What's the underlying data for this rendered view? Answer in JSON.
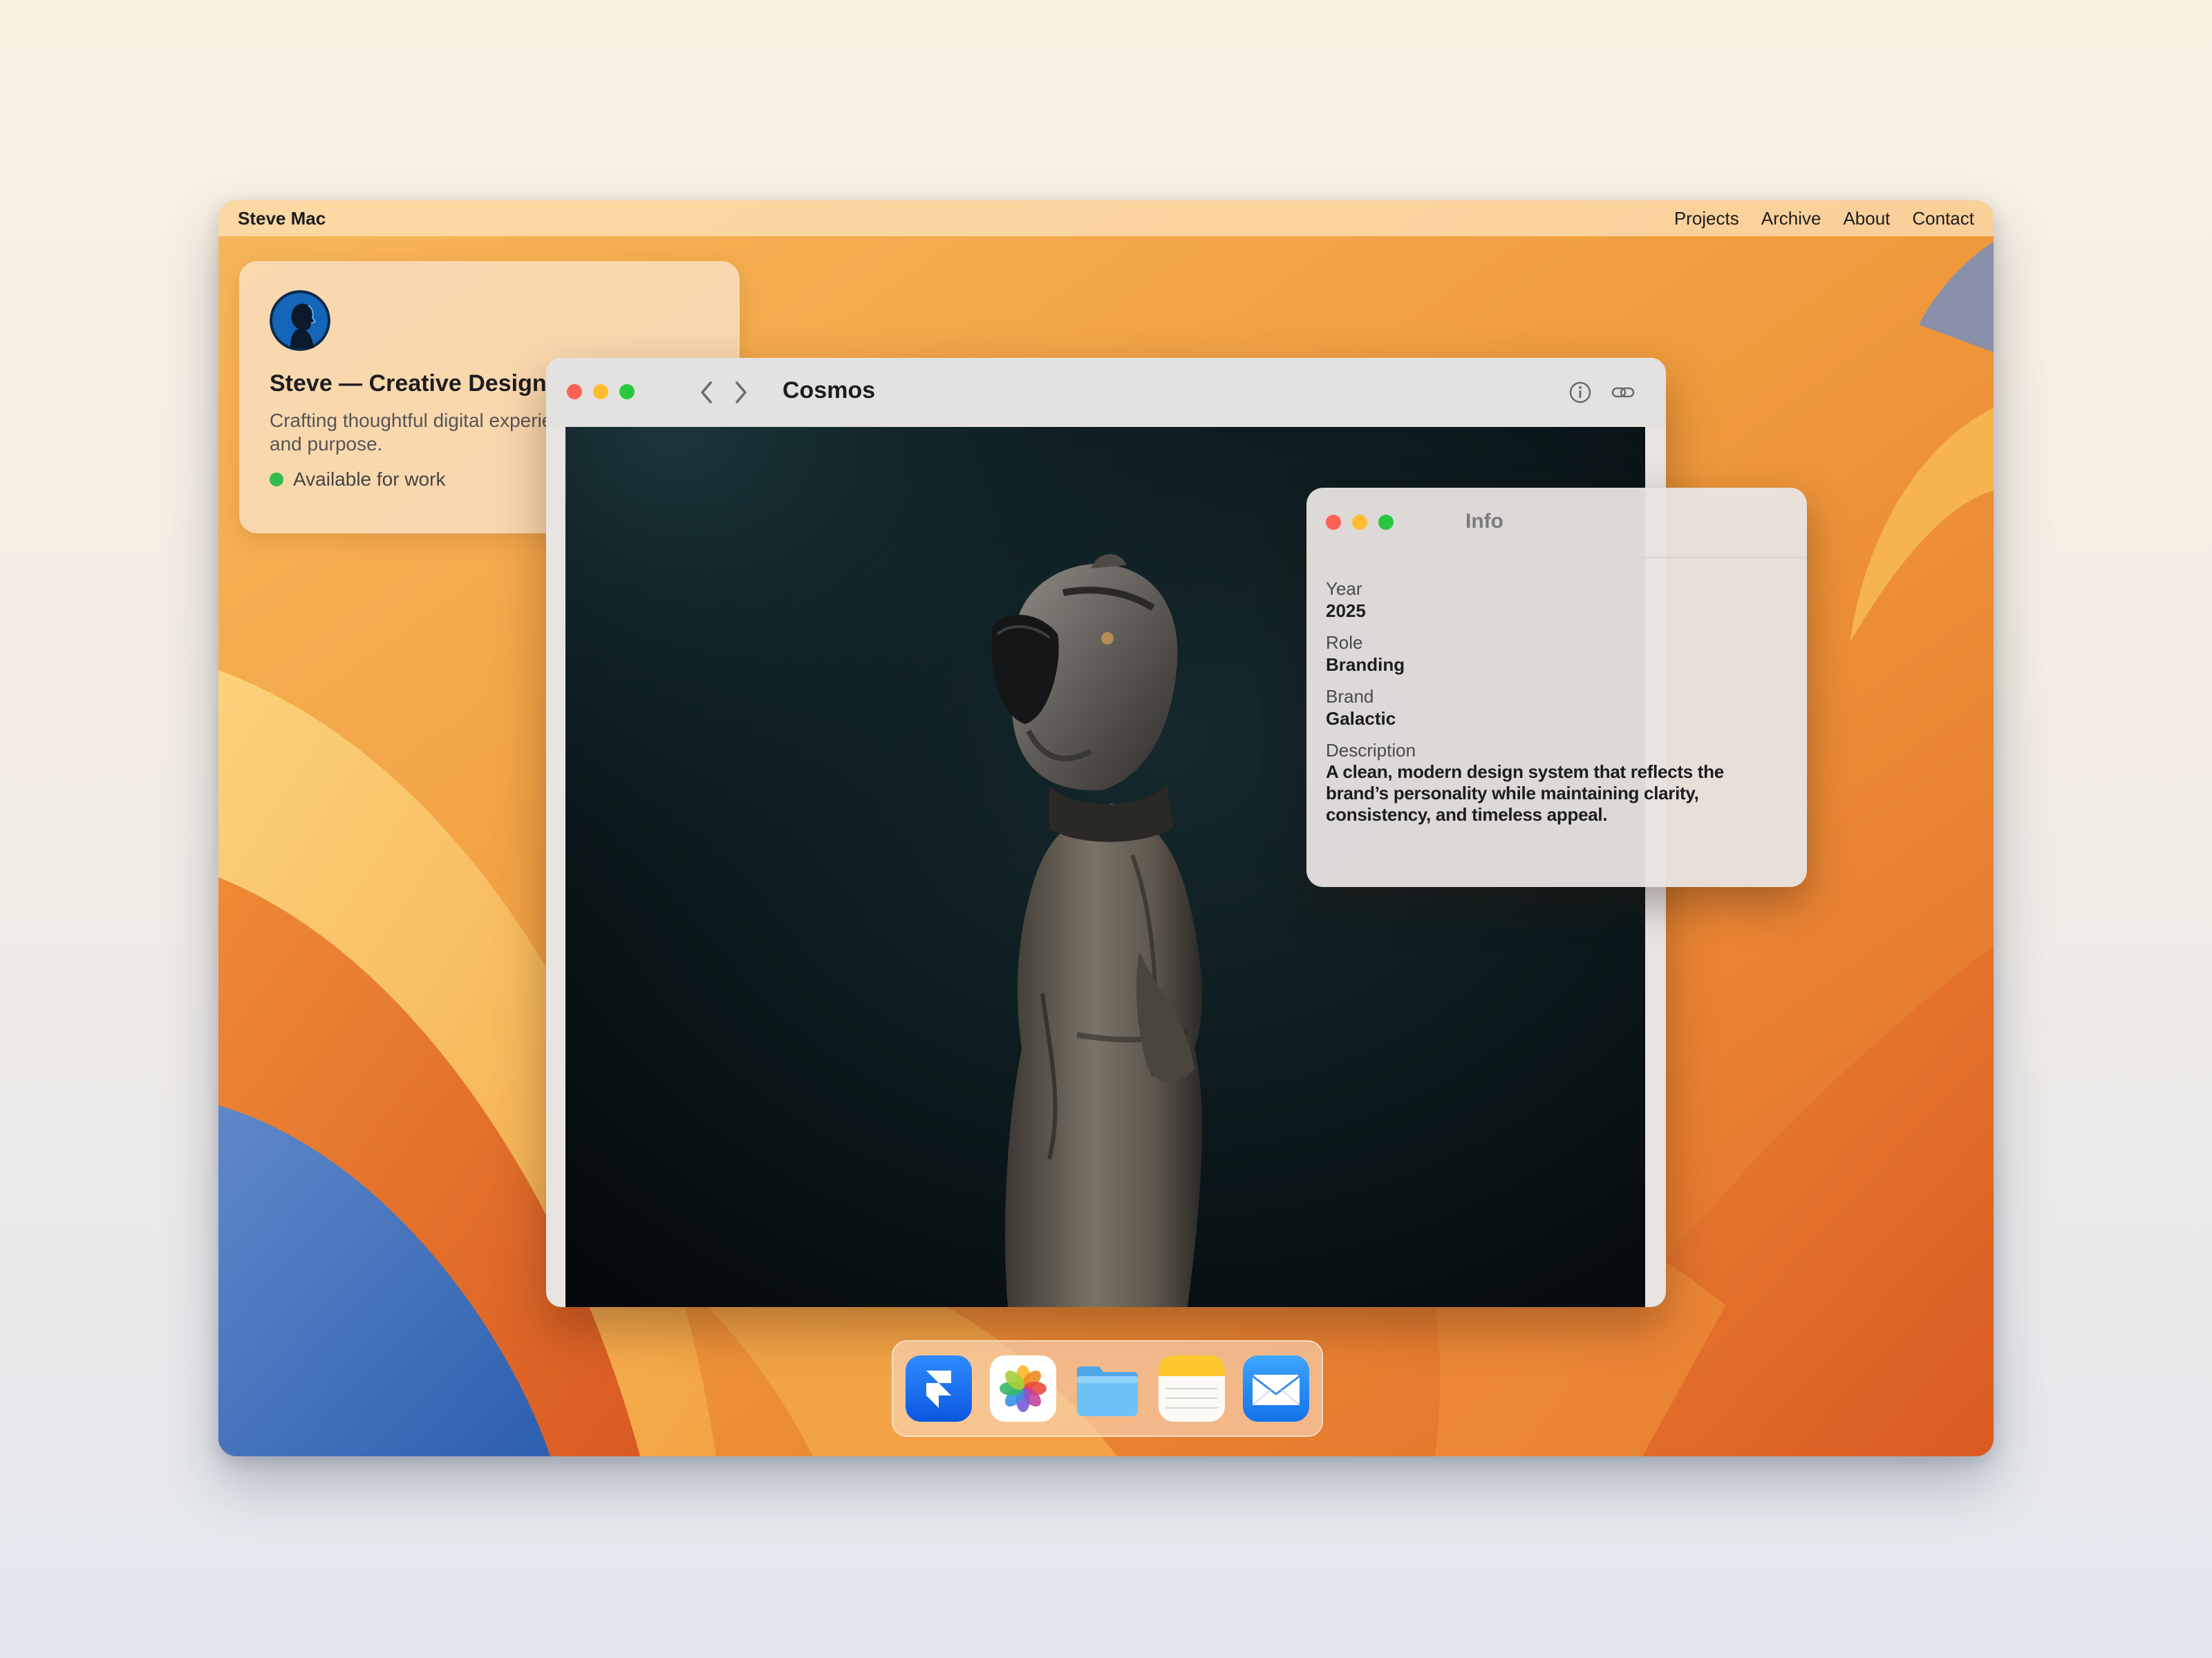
{
  "menubar": {
    "brand": "Steve Mac",
    "nav": [
      "Projects",
      "Archive",
      "About",
      "Contact"
    ]
  },
  "profile": {
    "title": "Steve — Creative Designer",
    "description": "Crafting thoughtful digital experiences with clarity and purpose.",
    "status": "Available for work",
    "status_color": "#2fbd4f"
  },
  "viewer": {
    "title": "Cosmos",
    "icons": [
      "chevron-left-icon",
      "chevron-right-icon",
      "info-icon",
      "link-icon"
    ]
  },
  "info_panel": {
    "title": "Info",
    "fields": [
      {
        "label": "Year",
        "value": "2025"
      },
      {
        "label": "Role",
        "value": "Branding"
      },
      {
        "label": "Brand",
        "value": "Galactic"
      },
      {
        "label": "Description",
        "value": "A clean, modern design system that reflects the brand’s personality while maintaining clarity, consistency, and timeless appeal."
      }
    ]
  },
  "dock": {
    "apps": [
      "framer-icon",
      "photos-icon",
      "files-icon",
      "notes-icon",
      "mail-icon"
    ]
  },
  "colors": {
    "traffic_red": "#fe5f57",
    "traffic_yellow": "#febc2e",
    "traffic_green": "#28c840"
  }
}
